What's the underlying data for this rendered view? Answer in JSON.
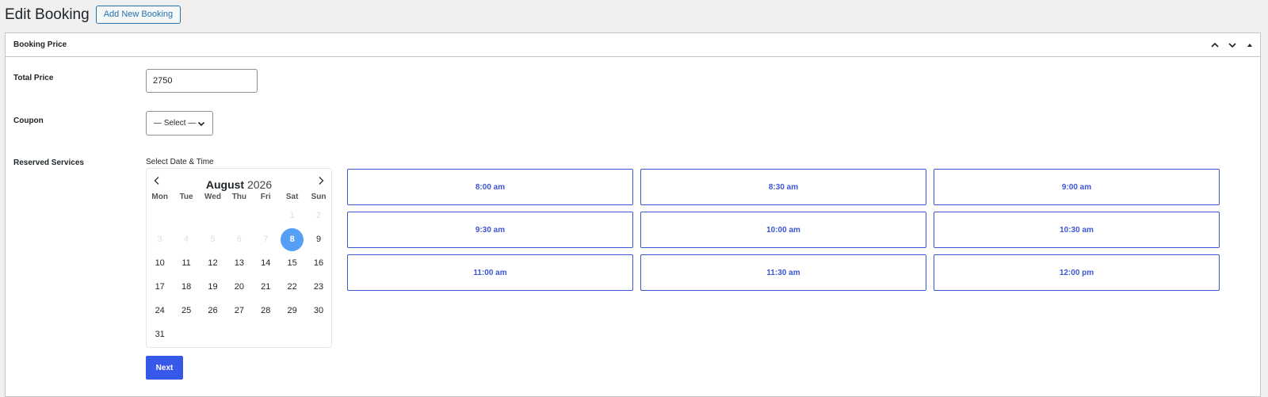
{
  "page": {
    "title": "Edit Booking",
    "add_new_label": "Add New Booking"
  },
  "postbox": {
    "title": "Booking Price",
    "actions": [
      "chevron-up-icon",
      "chevron-down-icon",
      "caret-up-icon"
    ]
  },
  "form": {
    "total_price_label": "Total Price",
    "total_price_value": "2750",
    "coupon_label": "Coupon",
    "coupon_selected": "— Select —",
    "reserved_services_label": "Reserved Services",
    "select_date_time_label": "Select Date & Time",
    "next_label": "Next"
  },
  "calendar": {
    "month": "August",
    "year": "2026",
    "weekdays": [
      "Mon",
      "Tue",
      "Wed",
      "Thu",
      "Fri",
      "Sat",
      "Sun"
    ],
    "days": [
      {
        "d": "",
        "state": "blank"
      },
      {
        "d": "",
        "state": "blank"
      },
      {
        "d": "",
        "state": "blank"
      },
      {
        "d": "",
        "state": "blank"
      },
      {
        "d": "",
        "state": "blank"
      },
      {
        "d": "1",
        "state": "disabled"
      },
      {
        "d": "2",
        "state": "disabled"
      },
      {
        "d": "3",
        "state": "disabled"
      },
      {
        "d": "4",
        "state": "disabled"
      },
      {
        "d": "5",
        "state": "disabled"
      },
      {
        "d": "6",
        "state": "disabled"
      },
      {
        "d": "7",
        "state": "disabled"
      },
      {
        "d": "8",
        "state": "selected"
      },
      {
        "d": "9",
        "state": "normal"
      },
      {
        "d": "10",
        "state": "normal"
      },
      {
        "d": "11",
        "state": "normal"
      },
      {
        "d": "12",
        "state": "normal"
      },
      {
        "d": "13",
        "state": "normal"
      },
      {
        "d": "14",
        "state": "normal"
      },
      {
        "d": "15",
        "state": "normal"
      },
      {
        "d": "16",
        "state": "normal"
      },
      {
        "d": "17",
        "state": "normal"
      },
      {
        "d": "18",
        "state": "normal"
      },
      {
        "d": "19",
        "state": "normal"
      },
      {
        "d": "20",
        "state": "normal"
      },
      {
        "d": "21",
        "state": "normal"
      },
      {
        "d": "22",
        "state": "normal"
      },
      {
        "d": "23",
        "state": "normal"
      },
      {
        "d": "24",
        "state": "normal"
      },
      {
        "d": "25",
        "state": "normal"
      },
      {
        "d": "26",
        "state": "normal"
      },
      {
        "d": "27",
        "state": "normal"
      },
      {
        "d": "28",
        "state": "normal"
      },
      {
        "d": "29",
        "state": "normal"
      },
      {
        "d": "30",
        "state": "normal"
      },
      {
        "d": "31",
        "state": "normal"
      }
    ]
  },
  "time_slots": [
    "8:00 am",
    "8:30 am",
    "9:00 am",
    "9:30 am",
    "10:00 am",
    "10:30 am",
    "11:00 am",
    "11:30 am",
    "12:00 pm"
  ],
  "colors": {
    "accent": "#3c55d4",
    "next_button": "#3858e9",
    "selected_day": "#569ff7",
    "wp_link_blue": "#2271b1"
  }
}
